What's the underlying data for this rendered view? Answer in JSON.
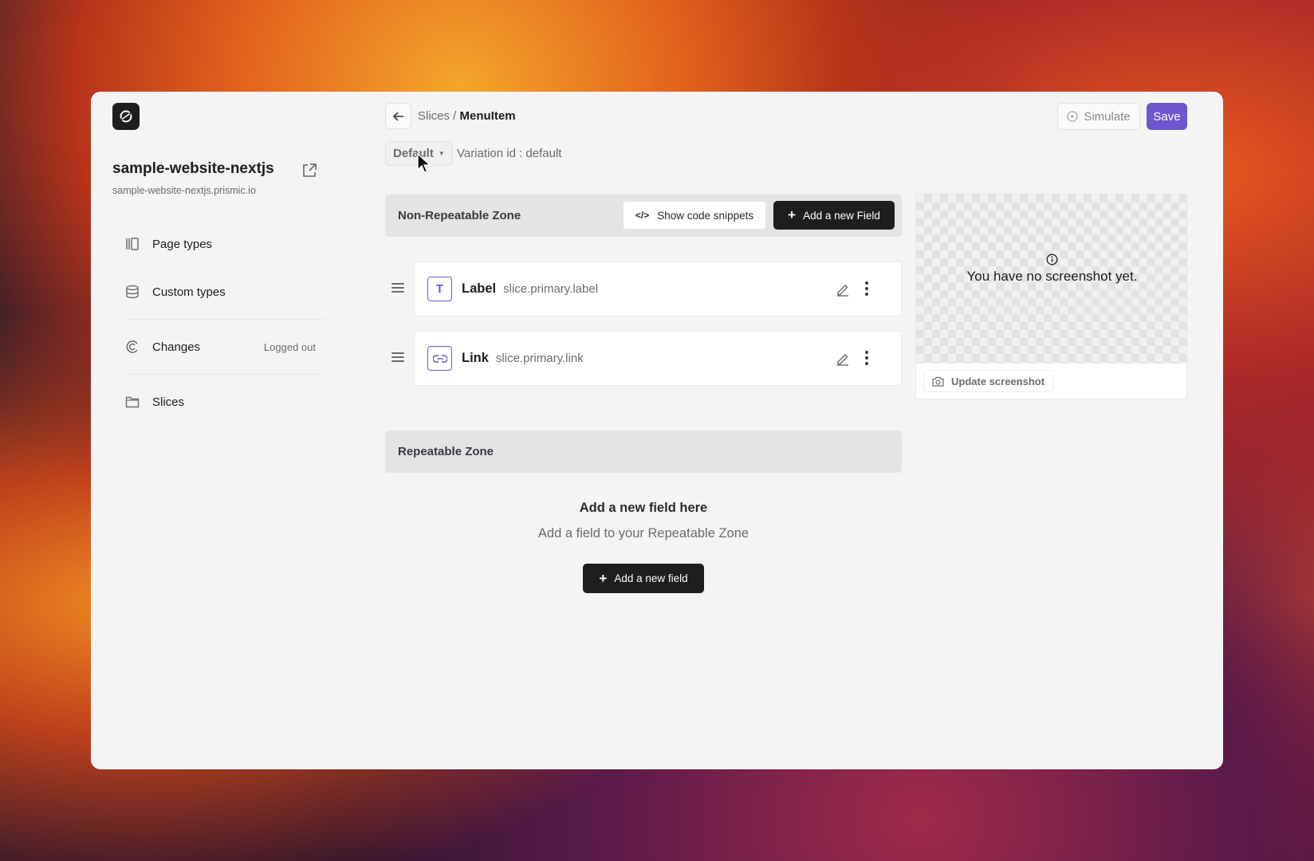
{
  "sidebar": {
    "project_name": "sample-website-nextjs",
    "project_url": "sample-website-nextjs.prismic.io",
    "items": [
      {
        "label": "Page types",
        "icon": "page-types-icon"
      },
      {
        "label": "Custom types",
        "icon": "database-icon"
      },
      {
        "label": "Changes",
        "icon": "changes-icon",
        "badge": "Logged out"
      },
      {
        "label": "Slices",
        "icon": "folder-icon"
      }
    ]
  },
  "header": {
    "breadcrumb_parent": "Slices /",
    "breadcrumb_current": "MenuItem",
    "simulate_label": "Simulate",
    "save_label": "Save",
    "variant_label": "Default",
    "variation_id": "Variation id : default"
  },
  "non_repeatable": {
    "title": "Non-Repeatable Zone",
    "snippets_label": "Show code snippets",
    "add_label": "Add a new Field",
    "fields": [
      {
        "type_glyph": "T",
        "name": "Label",
        "path": "slice.primary.label",
        "icon": "text-field-icon"
      },
      {
        "type_glyph": "link",
        "name": "Link",
        "path": "slice.primary.link",
        "icon": "link-field-icon"
      }
    ]
  },
  "repeatable": {
    "title": "Repeatable Zone",
    "empty_title": "Add a new field here",
    "empty_sub": "Add a field to your Repeatable Zone",
    "add_label": "Add a new field"
  },
  "screenshot": {
    "message": "You have no screenshot yet.",
    "update_label": "Update screenshot"
  },
  "colors": {
    "accent": "#6e56cf",
    "dark_button": "#1e1e20",
    "background": "#f4f4f5"
  }
}
